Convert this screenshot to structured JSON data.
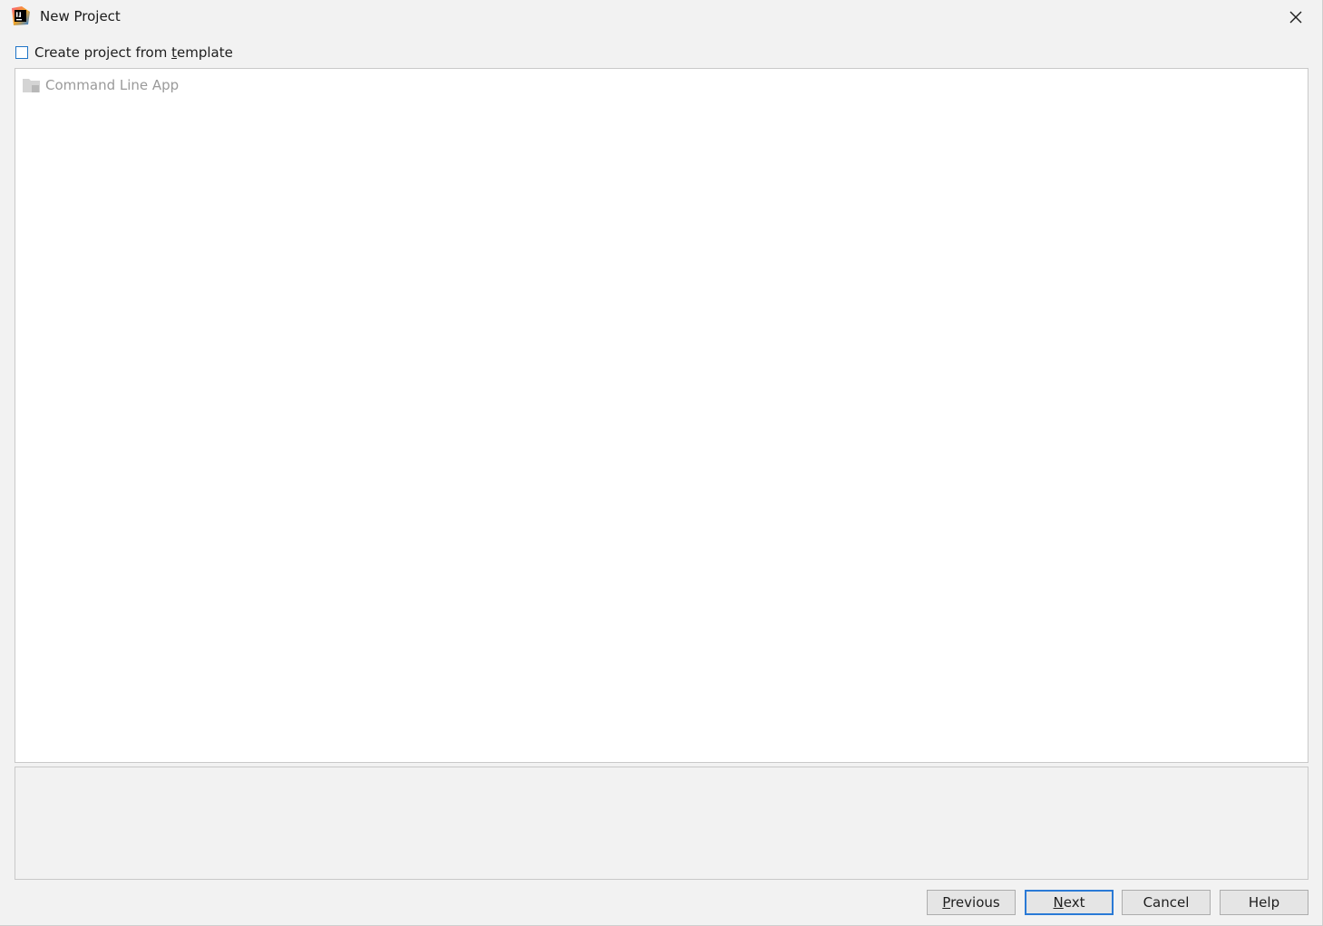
{
  "window": {
    "title": "New Project",
    "app_icon": "intellij-idea-icon",
    "close_icon": "close-icon"
  },
  "template_checkbox": {
    "checked": false,
    "label_before": "Create project from ",
    "label_mnemonic": "t",
    "label_after": "emplate"
  },
  "template_list": {
    "items": [
      {
        "label": "Command Line App",
        "icon": "folder-icon",
        "enabled": false
      }
    ]
  },
  "description": "",
  "buttons": {
    "previous": {
      "mnemonic": "P",
      "rest": "revious"
    },
    "next": {
      "mnemonic": "N",
      "rest": "ext"
    },
    "cancel": "Cancel",
    "help": "Help"
  },
  "colors": {
    "background": "#f2f2f2",
    "panel_border": "#c9c9c9",
    "focus_accent": "#2a7ad6",
    "disabled_text": "#9a9a9a"
  }
}
